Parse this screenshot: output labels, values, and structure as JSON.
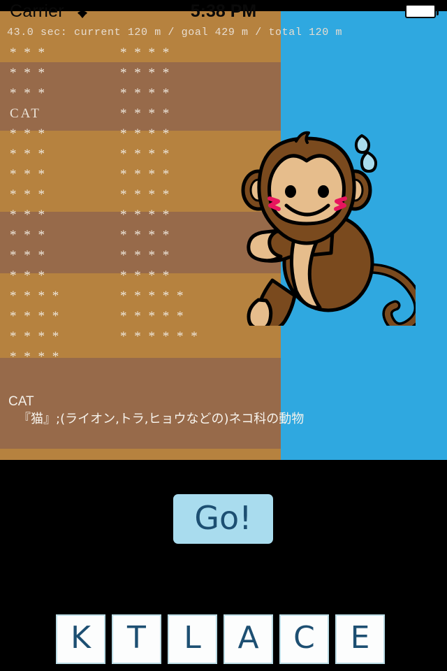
{
  "status_bar": {
    "carrier": "Carrier",
    "wifi_icon": "wifi-icon",
    "time": "5:38 PM",
    "battery_icon": "battery-icon"
  },
  "stats": {
    "line": "43.0 sec: current 120 m / goal 429 m / total 120 m",
    "elapsed_seconds": "43.0",
    "current_distance": "120 m",
    "goal_distance": "429 m",
    "total_distance": "120 m"
  },
  "colors": {
    "sky": "#2fa8e0",
    "wall_light": "#b6823f",
    "wall_dark": "#976a4a",
    "tile_face": "#fcfdfd",
    "tile_border": "#bcdde6",
    "accent_navy": "#1d4f72",
    "button_face": "#a9dcee",
    "monkey_body": "#7a4a1e",
    "monkey_face": "#e6bd8c",
    "cheek_pink": "#e8155e"
  },
  "word_rows": [
    {
      "left": "* * *",
      "right": "* * * *"
    },
    {
      "left": "* * *",
      "right": "* * * *"
    },
    {
      "left": "* * *",
      "right": "* * * *"
    },
    {
      "left": "CAT",
      "right": "* * * *"
    },
    {
      "left": "* * *",
      "right": "* * * *"
    },
    {
      "left": "* * *",
      "right": "* * * *"
    },
    {
      "left": "* * *",
      "right": "* * * *"
    },
    {
      "left": "* * *",
      "right": "* * * *"
    },
    {
      "left": "* * *",
      "right": "* * * *"
    },
    {
      "left": "* * *",
      "right": "* * * *"
    },
    {
      "left": "* * *",
      "right": "* * * *"
    },
    {
      "left": "* * *",
      "right": "* * * *"
    },
    {
      "left": "* * * *",
      "right": "* * * * *"
    },
    {
      "left": "* * * *",
      "right": "* * * * *"
    },
    {
      "left": "* * * *",
      "right": "* * * * * *"
    },
    {
      "left": "* * * *",
      "right": ""
    }
  ],
  "definition": {
    "word": "CAT",
    "text": "『猫』;(ライオン,トラ,ヒョウなどの)ネコ科の動物"
  },
  "character": {
    "name": "monkey-climber"
  },
  "go_button": {
    "label": "Go!"
  },
  "letter_tiles": [
    {
      "letter": "K"
    },
    {
      "letter": "T"
    },
    {
      "letter": "L"
    },
    {
      "letter": "A"
    },
    {
      "letter": "C"
    },
    {
      "letter": "E"
    }
  ]
}
